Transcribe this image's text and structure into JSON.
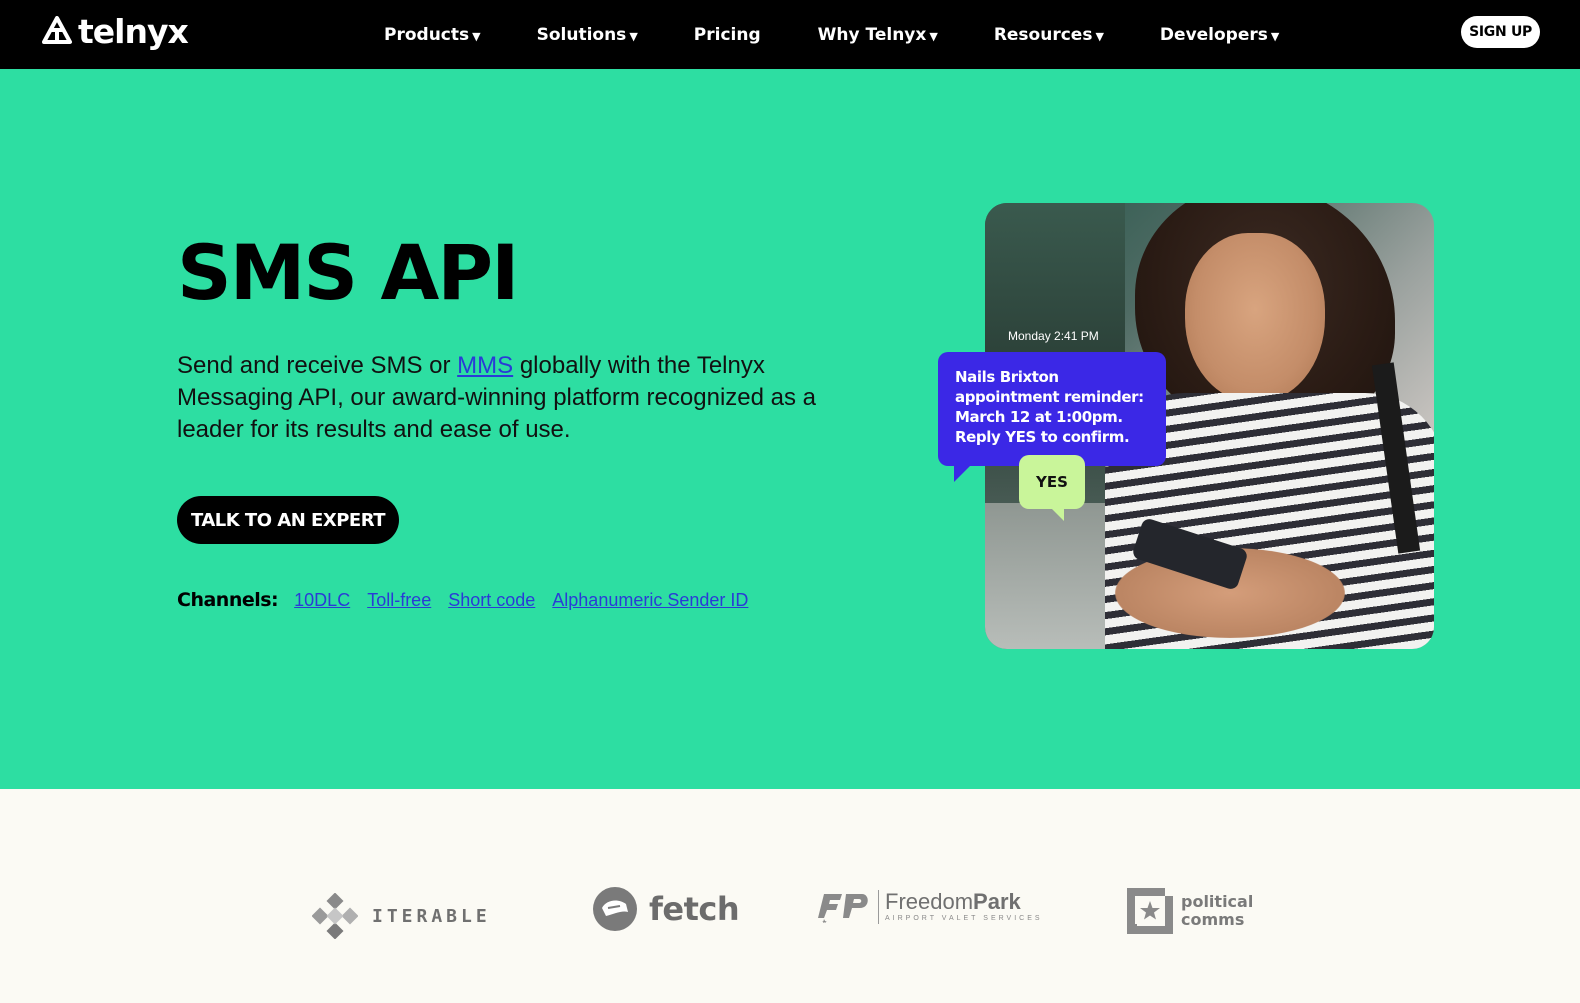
{
  "nav": {
    "brand": "telnyx",
    "items": [
      {
        "label": "Products",
        "has_dropdown": true
      },
      {
        "label": "Solutions",
        "has_dropdown": true
      },
      {
        "label": "Pricing",
        "has_dropdown": false
      },
      {
        "label": "Why Telnyx",
        "has_dropdown": true
      },
      {
        "label": "Resources",
        "has_dropdown": true
      },
      {
        "label": "Developers",
        "has_dropdown": true
      }
    ],
    "dropdown_caret": "▼",
    "signup_label": "SIGN UP"
  },
  "hero": {
    "title": "SMS API",
    "desc_before": "Send and receive SMS or ",
    "desc_link": "MMS",
    "desc_after": " globally with the Telnyx Messaging API, our award-winning platform recognized as a leader for its results and ease of use.",
    "cta_label": "TALK TO AN EXPERT",
    "channels_label": "Channels:",
    "channels": [
      "10DLC",
      "Toll-free",
      "Short code",
      "Alphanumeric Sender ID"
    ],
    "background_color": "#2ddea2"
  },
  "message_mock": {
    "timestamp": "Monday 2:41 PM",
    "message_lines": [
      "Nails Brixton",
      "appointment reminder:",
      "March 12 at 1:00pm.",
      "Reply YES to confirm."
    ],
    "reply": "YES"
  },
  "customers": [
    {
      "name": "ITERABLE",
      "icon": "iterable-logo-icon"
    },
    {
      "name": "fetch",
      "icon": "fetch-logo-icon"
    },
    {
      "name_regular": "Freedom",
      "name_bold": "Park",
      "sub": "AIRPORT VALET SERVICES",
      "icon": "freedompark-logo-icon"
    },
    {
      "name_line1": "political",
      "name_line2": "comms",
      "icon": "politicalcomms-logo-icon"
    }
  ],
  "colors": {
    "accent_link": "#2a3bd6",
    "bubble_blue": "#3b28e6",
    "bubble_green": "#c9f59a"
  }
}
